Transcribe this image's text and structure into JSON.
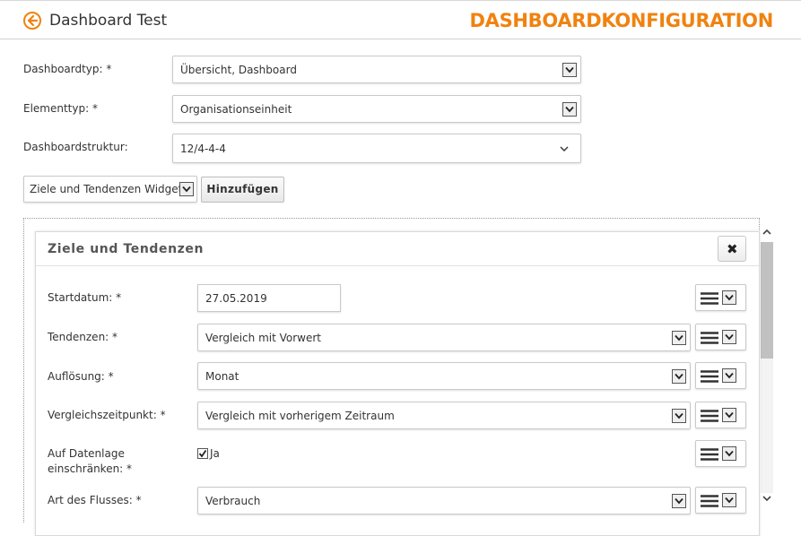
{
  "header": {
    "back_icon": "arrow-left-circle-icon",
    "title": "Dashboard Test",
    "heading": "DASHBOARDKONFIGURATION",
    "accent_color": "#f0820f"
  },
  "form": {
    "dashboard_type": {
      "label": "Dashboardtyp: *",
      "value": "Übersicht, Dashboard"
    },
    "element_type": {
      "label": "Elementtyp: *",
      "value": "Organisationseinheit"
    },
    "structure": {
      "label": "Dashboardstruktur:",
      "value": "12/4-4-4"
    },
    "widget_select": {
      "value": "Ziele und Tendenzen Widget"
    },
    "add_button": "Hinzufügen"
  },
  "widget": {
    "title": "Ziele und Tendenzen",
    "close_icon": "close-x-icon",
    "fields": {
      "start_date": {
        "label": "Startdatum: *",
        "value": "27.05.2019"
      },
      "trends": {
        "label": "Tendenzen: *",
        "value": "Vergleich mit Vorwert"
      },
      "resolution": {
        "label": "Auflösung: *",
        "value": "Monat"
      },
      "comparison": {
        "label": "Vergleichszeitpunkt: *",
        "value": "Vergleich mit vorherigem Zeitraum"
      },
      "restrict_line1": "Auf Datenlage",
      "restrict_line2": "einschränken: *",
      "restrict_value": "Ja",
      "flow_type": {
        "label": "Art des Flusses: *",
        "value": "Verbrauch"
      }
    }
  }
}
